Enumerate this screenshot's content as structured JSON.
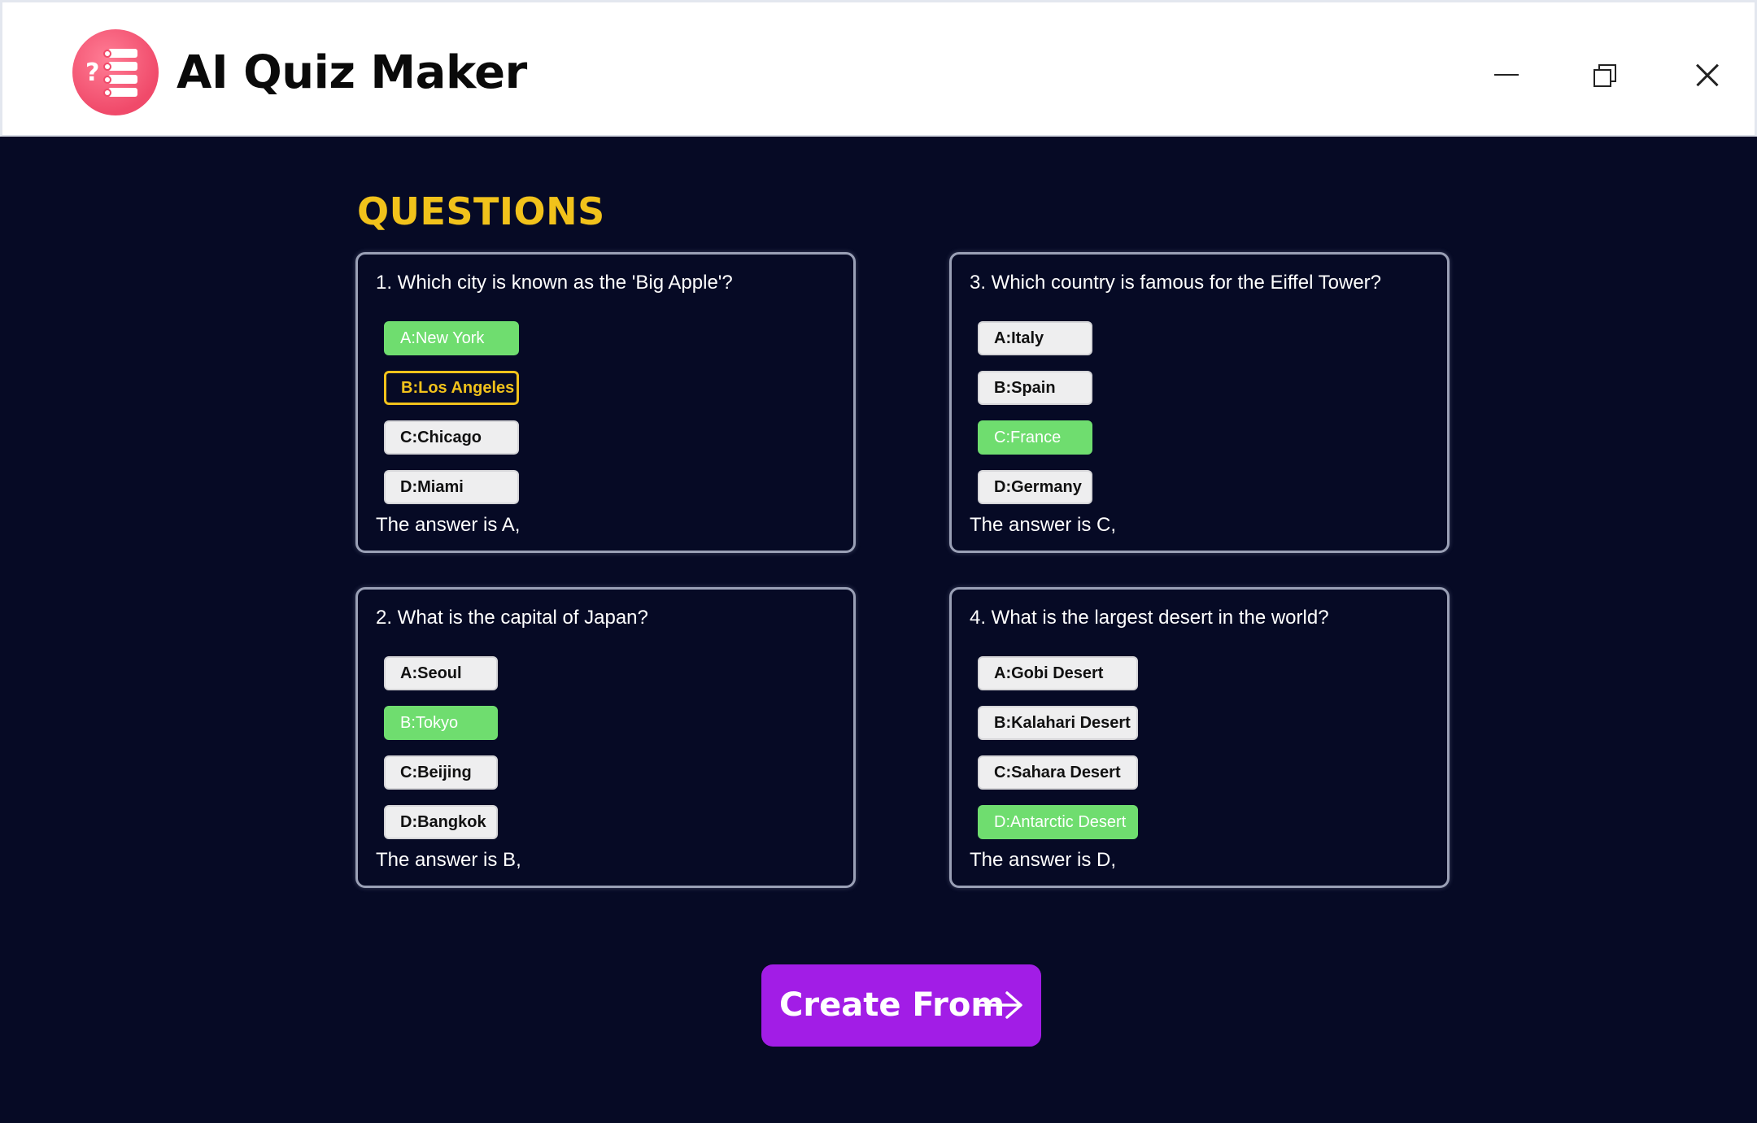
{
  "window": {
    "title": "AI Quiz Maker",
    "logo_icon": "quiz-list-icon",
    "logo_question_mark": "?",
    "logo_item_letters": [
      "A.",
      "B.",
      "C.",
      "D."
    ],
    "controls": [
      "minimize-icon",
      "restore-icon",
      "close-icon"
    ]
  },
  "main": {
    "heading": "QUESTIONS",
    "questions": [
      {
        "text": "1. Which city is known as the 'Big Apple'?",
        "options": [
          "A:New York",
          "B:Los Angeles",
          "C:Chicago",
          "D:Miami"
        ],
        "correct": "A",
        "selected": "B",
        "answer_text": "The answer is A,"
      },
      {
        "text": "2. What is the capital of Japan?",
        "options": [
          "A:Seoul",
          "B:Tokyo",
          "C:Beijing",
          "D:Bangkok"
        ],
        "correct": "B",
        "answer_text": "The answer is B,"
      },
      {
        "text": "3. Which country is famous for the Eiffel Tower?",
        "options": [
          "A:Italy",
          "B:Spain",
          "C:France",
          "D:Germany"
        ],
        "correct": "C",
        "answer_text": "The answer is C,"
      },
      {
        "text": "4. What is the largest desert in the world?",
        "options": [
          "A:Gobi Desert",
          "B:Kalahari Desert",
          "C:Sahara Desert",
          "D:Antarctic Desert"
        ],
        "correct": "D",
        "answer_text": "The answer is D,"
      }
    ],
    "create_button": {
      "label": "Create From",
      "icon": "arrow-right-icon"
    }
  },
  "colors": {
    "background": "#060a25",
    "heading": "#f1c21b",
    "correct": "#6fdd6f",
    "selected_border": "#f1c21b",
    "create_button": "#a21de6",
    "logo": "#f04a6a"
  }
}
